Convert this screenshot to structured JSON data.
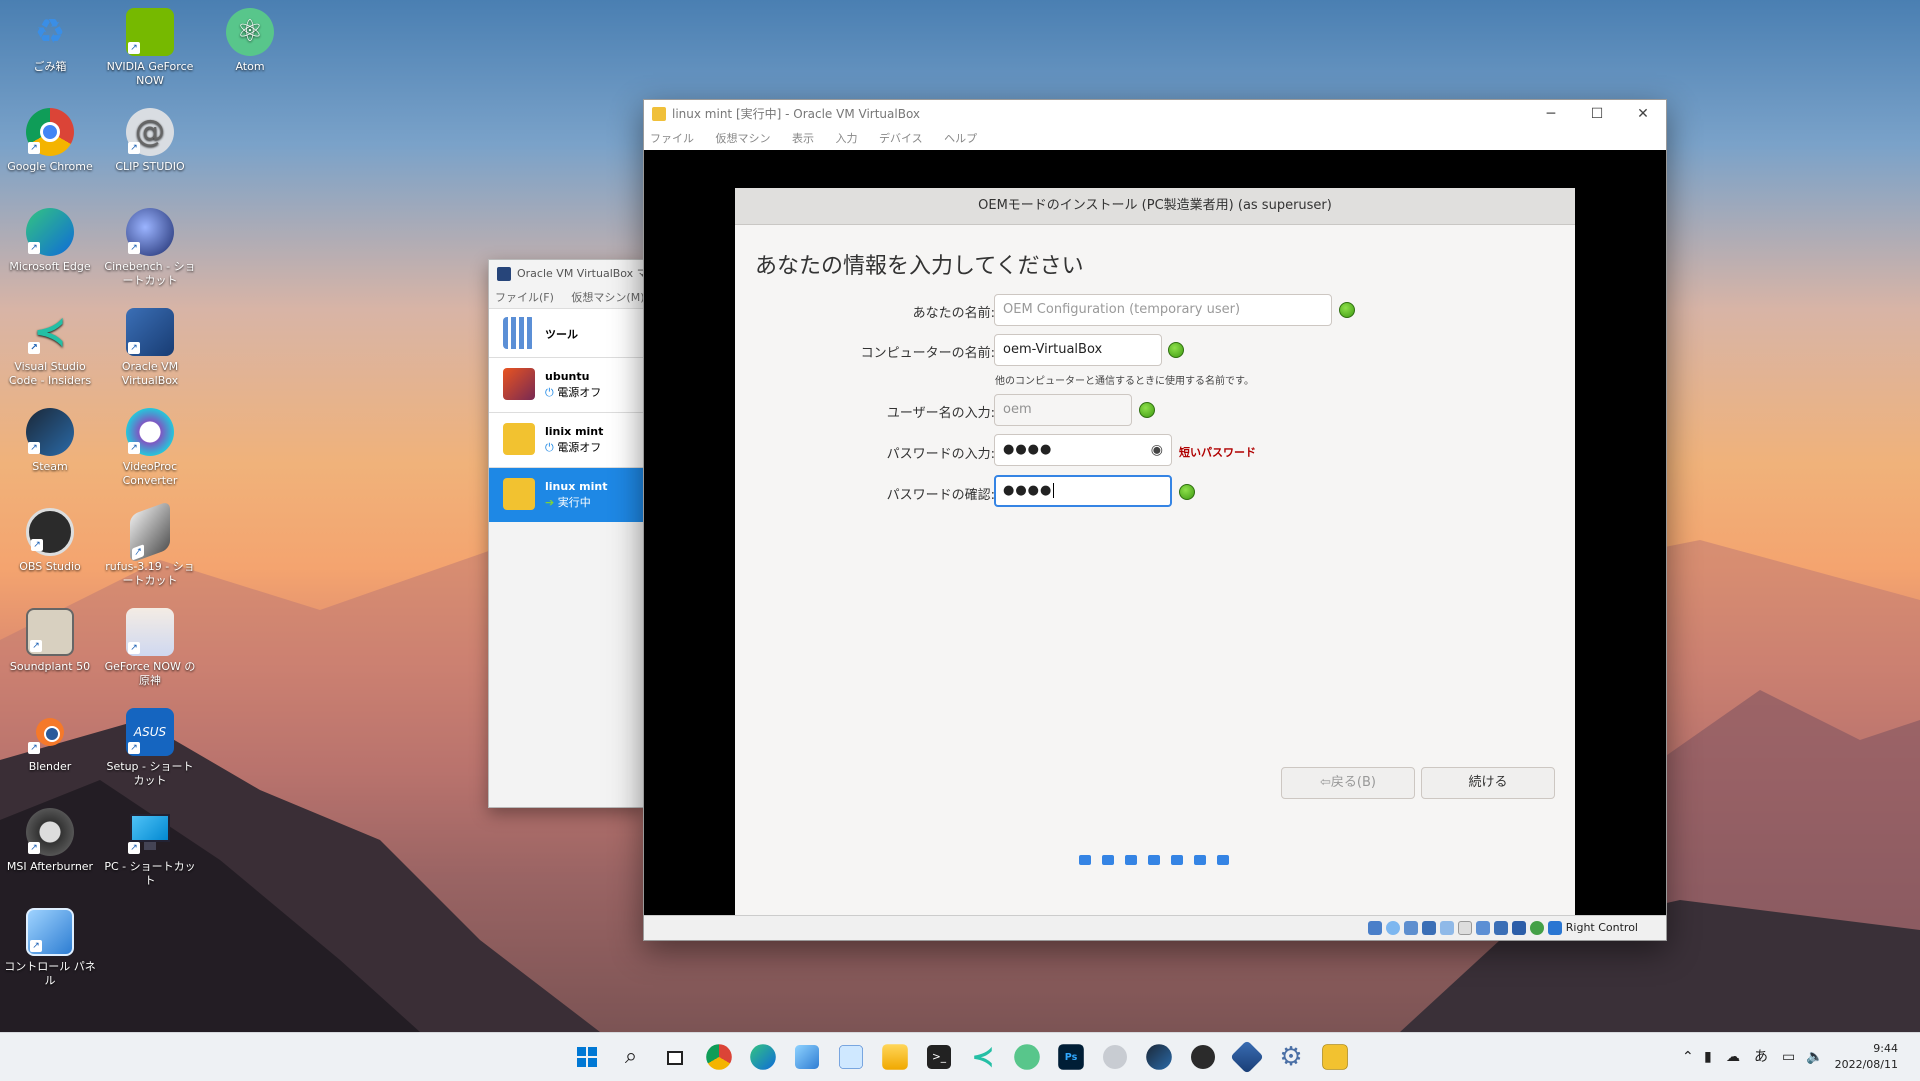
{
  "desktop_icons": [
    {
      "label": "ごみ箱",
      "icon": "recycle-bin-icon"
    },
    {
      "label": "NVIDIA GeForce NOW",
      "icon": "nvidia-icon"
    },
    {
      "label": "Atom",
      "icon": "atom-icon"
    },
    {
      "label": "Google Chrome",
      "icon": "chrome-icon"
    },
    {
      "label": "CLIP STUDIO",
      "icon": "clip-studio-icon"
    },
    {
      "label": "Microsoft Edge",
      "icon": "edge-icon"
    },
    {
      "label": "Cinebench - ショートカット",
      "icon": "cinebench-icon"
    },
    {
      "label": "Visual Studio Code - Insiders",
      "icon": "vscode-icon"
    },
    {
      "label": "Oracle VM VirtualBox",
      "icon": "virtualbox-icon"
    },
    {
      "label": "Steam",
      "icon": "steam-icon"
    },
    {
      "label": "VideoProc Converter",
      "icon": "videoproc-icon"
    },
    {
      "label": "OBS Studio",
      "icon": "obs-icon"
    },
    {
      "label": "rufus-3.19 - ショートカット",
      "icon": "usb-icon"
    },
    {
      "label": "Soundplant 50",
      "icon": "soundplant-icon"
    },
    {
      "label": "GeForce NOW の原神",
      "icon": "genshin-icon"
    },
    {
      "label": "Blender",
      "icon": "blender-icon"
    },
    {
      "label": "Setup - ショートカット",
      "icon": "asus-setup-icon"
    },
    {
      "label": "MSI Afterburner",
      "icon": "msi-afterburner-icon"
    },
    {
      "label": "PC - ショートカット",
      "icon": "pc-icon"
    },
    {
      "label": "コントロール パネル",
      "icon": "control-panel-icon"
    }
  ],
  "manager": {
    "title": "Oracle VM VirtualBox マ",
    "menu": [
      "ファイル(F)",
      "仮想マシン(M)"
    ],
    "tools_label": "ツール",
    "vms": [
      {
        "name": "ubuntu",
        "state": "電源オフ"
      },
      {
        "name": "linix mint",
        "state": "電源オフ"
      },
      {
        "name": "linux mint",
        "state": "実行中"
      }
    ]
  },
  "vm_window": {
    "title": "linux mint [実行中] - Oracle VM VirtualBox",
    "menu": [
      "ファイル",
      "仮想マシン",
      "表示",
      "入力",
      "デバイス",
      "ヘルプ"
    ],
    "minimize": "─",
    "maximize": "☐",
    "close": "✕",
    "host_key": "Right Control"
  },
  "installer": {
    "header": "OEMモードのインストール (PC製造業者用) (as superuser)",
    "heading": "あなたの情報を入力してください",
    "name_label": "あなたの名前:",
    "name_placeholder": "OEM Configuration (temporary user)",
    "computer_label": "コンピューターの名前:",
    "computer_value": "oem-VirtualBox",
    "computer_hint": "他のコンピューターと通信するときに使用する名前です。",
    "user_label": "ユーザー名の入力:",
    "user_value": "oem",
    "password_label": "パスワードの入力:",
    "password_value": "●●●●",
    "password_warning": "短いパスワード",
    "confirm_label": "パスワードの確認:",
    "confirm_value": "●●●●",
    "back_button": "戻る(B)",
    "continue_button": "続ける",
    "progress_steps": 7
  },
  "taskbar": {
    "ime": "あ",
    "time": "9:44",
    "date": "2022/08/11"
  },
  "colors": {
    "accent": "#3584e4",
    "selected": "#1e88e5",
    "ok_green": "#4caf1f",
    "warning": "#b00000"
  }
}
